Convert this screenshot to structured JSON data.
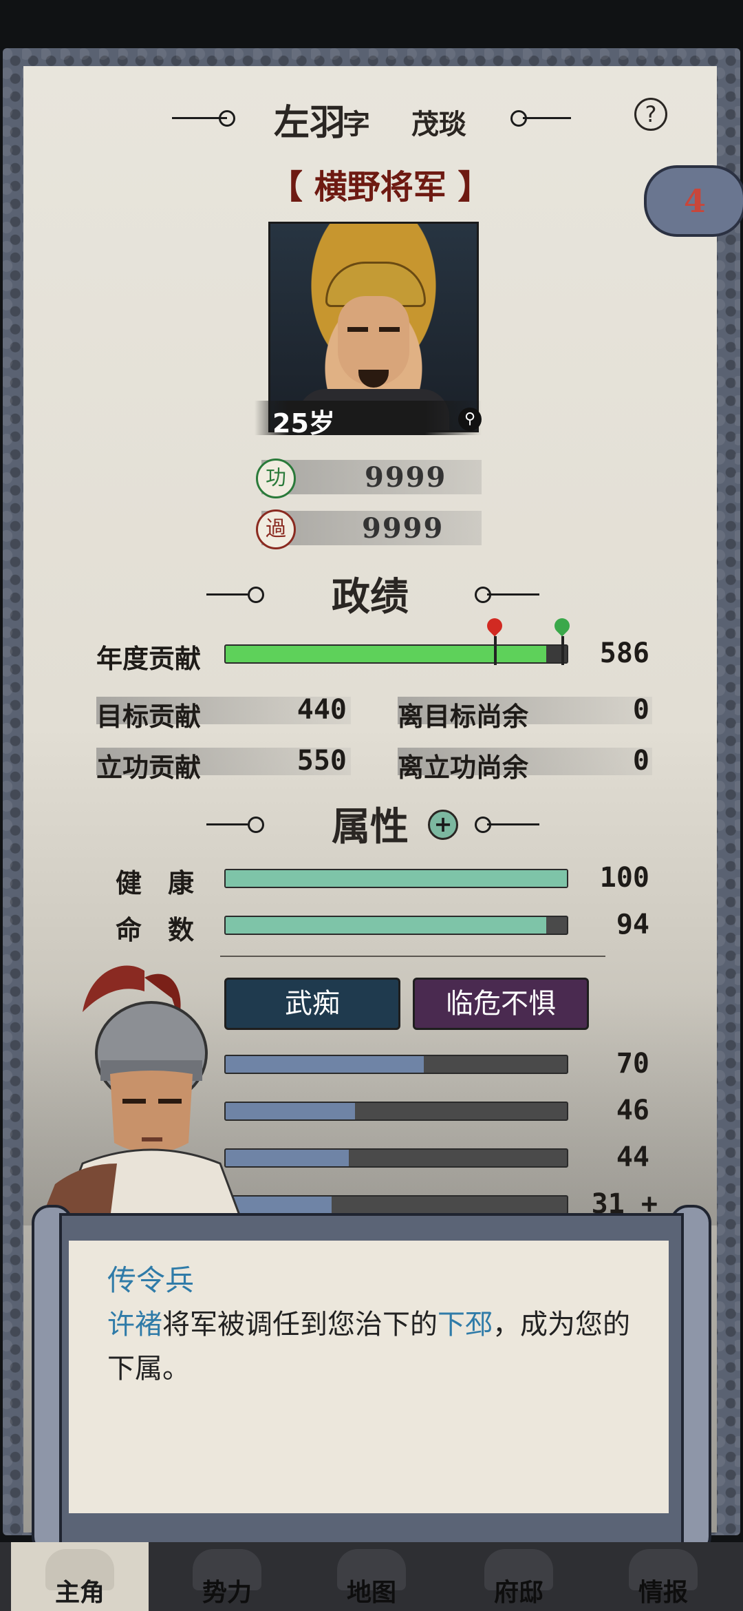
{
  "header": {
    "name": "左羽",
    "zi_label": "字",
    "courtesy": "茂琰",
    "help_symbol": "?",
    "rank": "【 横野将军 】",
    "badge_count": "4"
  },
  "portrait": {
    "age": "25岁"
  },
  "merits": [
    {
      "icon": "功",
      "value": "9999"
    },
    {
      "icon": "過",
      "value": "9999"
    }
  ],
  "performance": {
    "title": "政绩",
    "annual_label": "年度贡献",
    "annual_value": "586",
    "annual_progress": 0.94,
    "target_label": "目标贡献",
    "target_value": "440",
    "merit_label": "立功贡献",
    "merit_value": "550",
    "to_target_label": "离目标尚余",
    "to_target_value": "0",
    "to_merit_label": "离立功尚余",
    "to_merit_value": "0"
  },
  "attributes": {
    "title": "属性",
    "plus": "+",
    "health_label": "健　康",
    "health_value": "100",
    "health_progress": 1.0,
    "fate_label": "命　数",
    "fate_value": "94",
    "fate_progress": 0.94
  },
  "traits": [
    "武痴",
    "临危不惧"
  ],
  "stats": [
    {
      "value": "70",
      "progress": 0.58
    },
    {
      "value": "46",
      "progress": 0.38
    },
    {
      "value": "44",
      "progress": 0.36
    },
    {
      "value": "31 +",
      "progress": 0.31
    }
  ],
  "dialog": {
    "speaker": "传令兵",
    "hl1": "许褚",
    "text1": "将军被调任到您治下的",
    "hl2": "下邳",
    "text2": "，成为您的下属。"
  },
  "nav": [
    "主角",
    "势力",
    "地图",
    "府邸",
    "情报"
  ],
  "colors": {
    "accent_blue": "#2f7ba8",
    "rank_red": "#6e1a12",
    "annual_green": "#5ed15a",
    "health_teal": "#7ec4a8",
    "stat_blue": "#6f84a6",
    "trait1_bg": "#1f3a4e",
    "trait2_bg": "#4a2a50"
  }
}
